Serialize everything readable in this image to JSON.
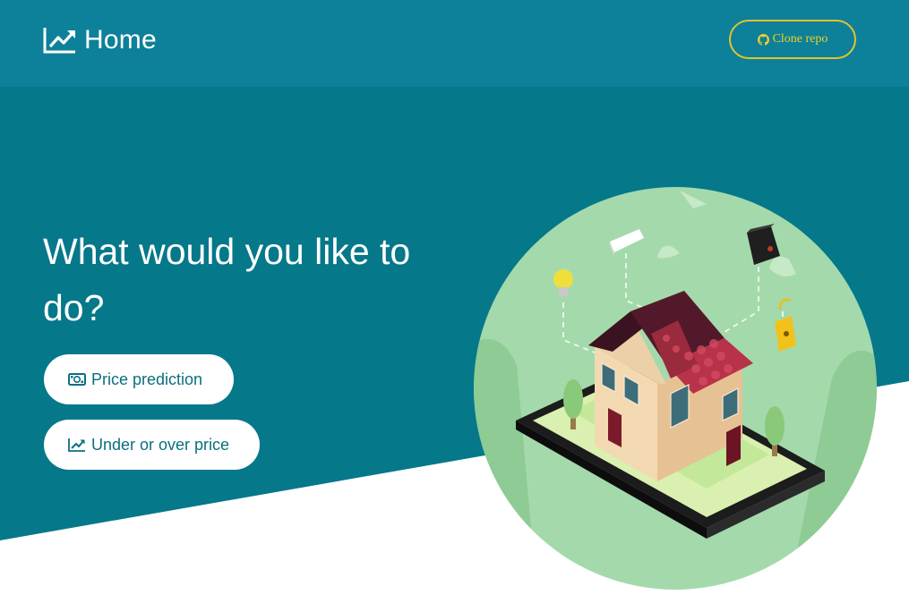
{
  "navbar": {
    "brand_icon": "chart-line-icon",
    "title": "Home",
    "clone_button": {
      "label": "Clone repo",
      "icon": "github-icon"
    }
  },
  "hero": {
    "headline": "What would you like to do?",
    "actions": [
      {
        "label": "Price prediction",
        "icon": "money-bill-icon"
      },
      {
        "label": "Under or over price",
        "icon": "chart-line-icon"
      }
    ],
    "illustration": "smart-home-illustration"
  },
  "colors": {
    "navbar": "#0d8199",
    "hero": "#05788a",
    "accent": "#e3c22e",
    "button_text": "#0b6f80",
    "illustration_bg": "#a4d9ac"
  }
}
